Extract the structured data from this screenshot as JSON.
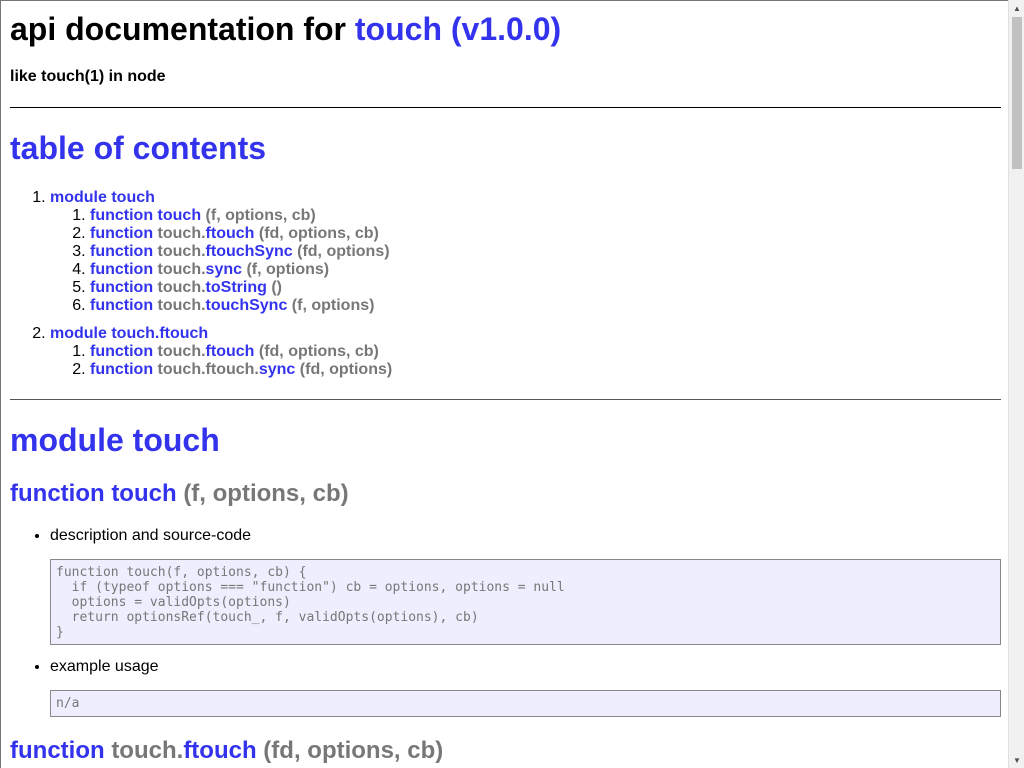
{
  "header": {
    "title_prefix": "api documentation for",
    "title_link": "touch (v1.0.0)",
    "subtitle": "like touch(1) in node"
  },
  "toc": {
    "title": "table of contents",
    "modules": [
      {
        "label": "module touch",
        "items": [
          {
            "kw": "function",
            "ns": "",
            "name": "touch",
            "args": "(f, options, cb)"
          },
          {
            "kw": "function",
            "ns": "touch.",
            "name": "ftouch",
            "args": "(fd, options, cb)"
          },
          {
            "kw": "function",
            "ns": "touch.",
            "name": "ftouchSync",
            "args": "(fd, options)"
          },
          {
            "kw": "function",
            "ns": "touch.",
            "name": "sync",
            "args": "(f, options)"
          },
          {
            "kw": "function",
            "ns": "touch.",
            "name": "toString",
            "args": "()"
          },
          {
            "kw": "function",
            "ns": "touch.",
            "name": "touchSync",
            "args": "(f, options)"
          }
        ]
      },
      {
        "label": "module touch.ftouch",
        "items": [
          {
            "kw": "function",
            "ns": "touch.",
            "name": "ftouch",
            "args": "(fd, options, cb)"
          },
          {
            "kw": "function",
            "ns": "touch.ftouch.",
            "name": "sync",
            "args": "(fd, options)"
          }
        ]
      }
    ]
  },
  "module": {
    "title": "module touch",
    "fn1": {
      "kw": "function",
      "name": "touch",
      "args": "(f, options, cb)",
      "desc_label": "description and source-code",
      "code": "function touch(f, options, cb) {\n  if (typeof options === \"function\") cb = options, options = null\n  options = validOpts(options)\n  return optionsRef(touch_, f, validOpts(options), cb)\n}",
      "example_label": "example usage",
      "example_code": "n/a"
    },
    "fn2": {
      "kw": "function",
      "ns": "touch.",
      "name": "ftouch",
      "args": "(fd, options, cb)"
    }
  },
  "colors": {
    "link": "#3333ee",
    "muted": "#777777",
    "code_bg": "#eeeeff"
  }
}
